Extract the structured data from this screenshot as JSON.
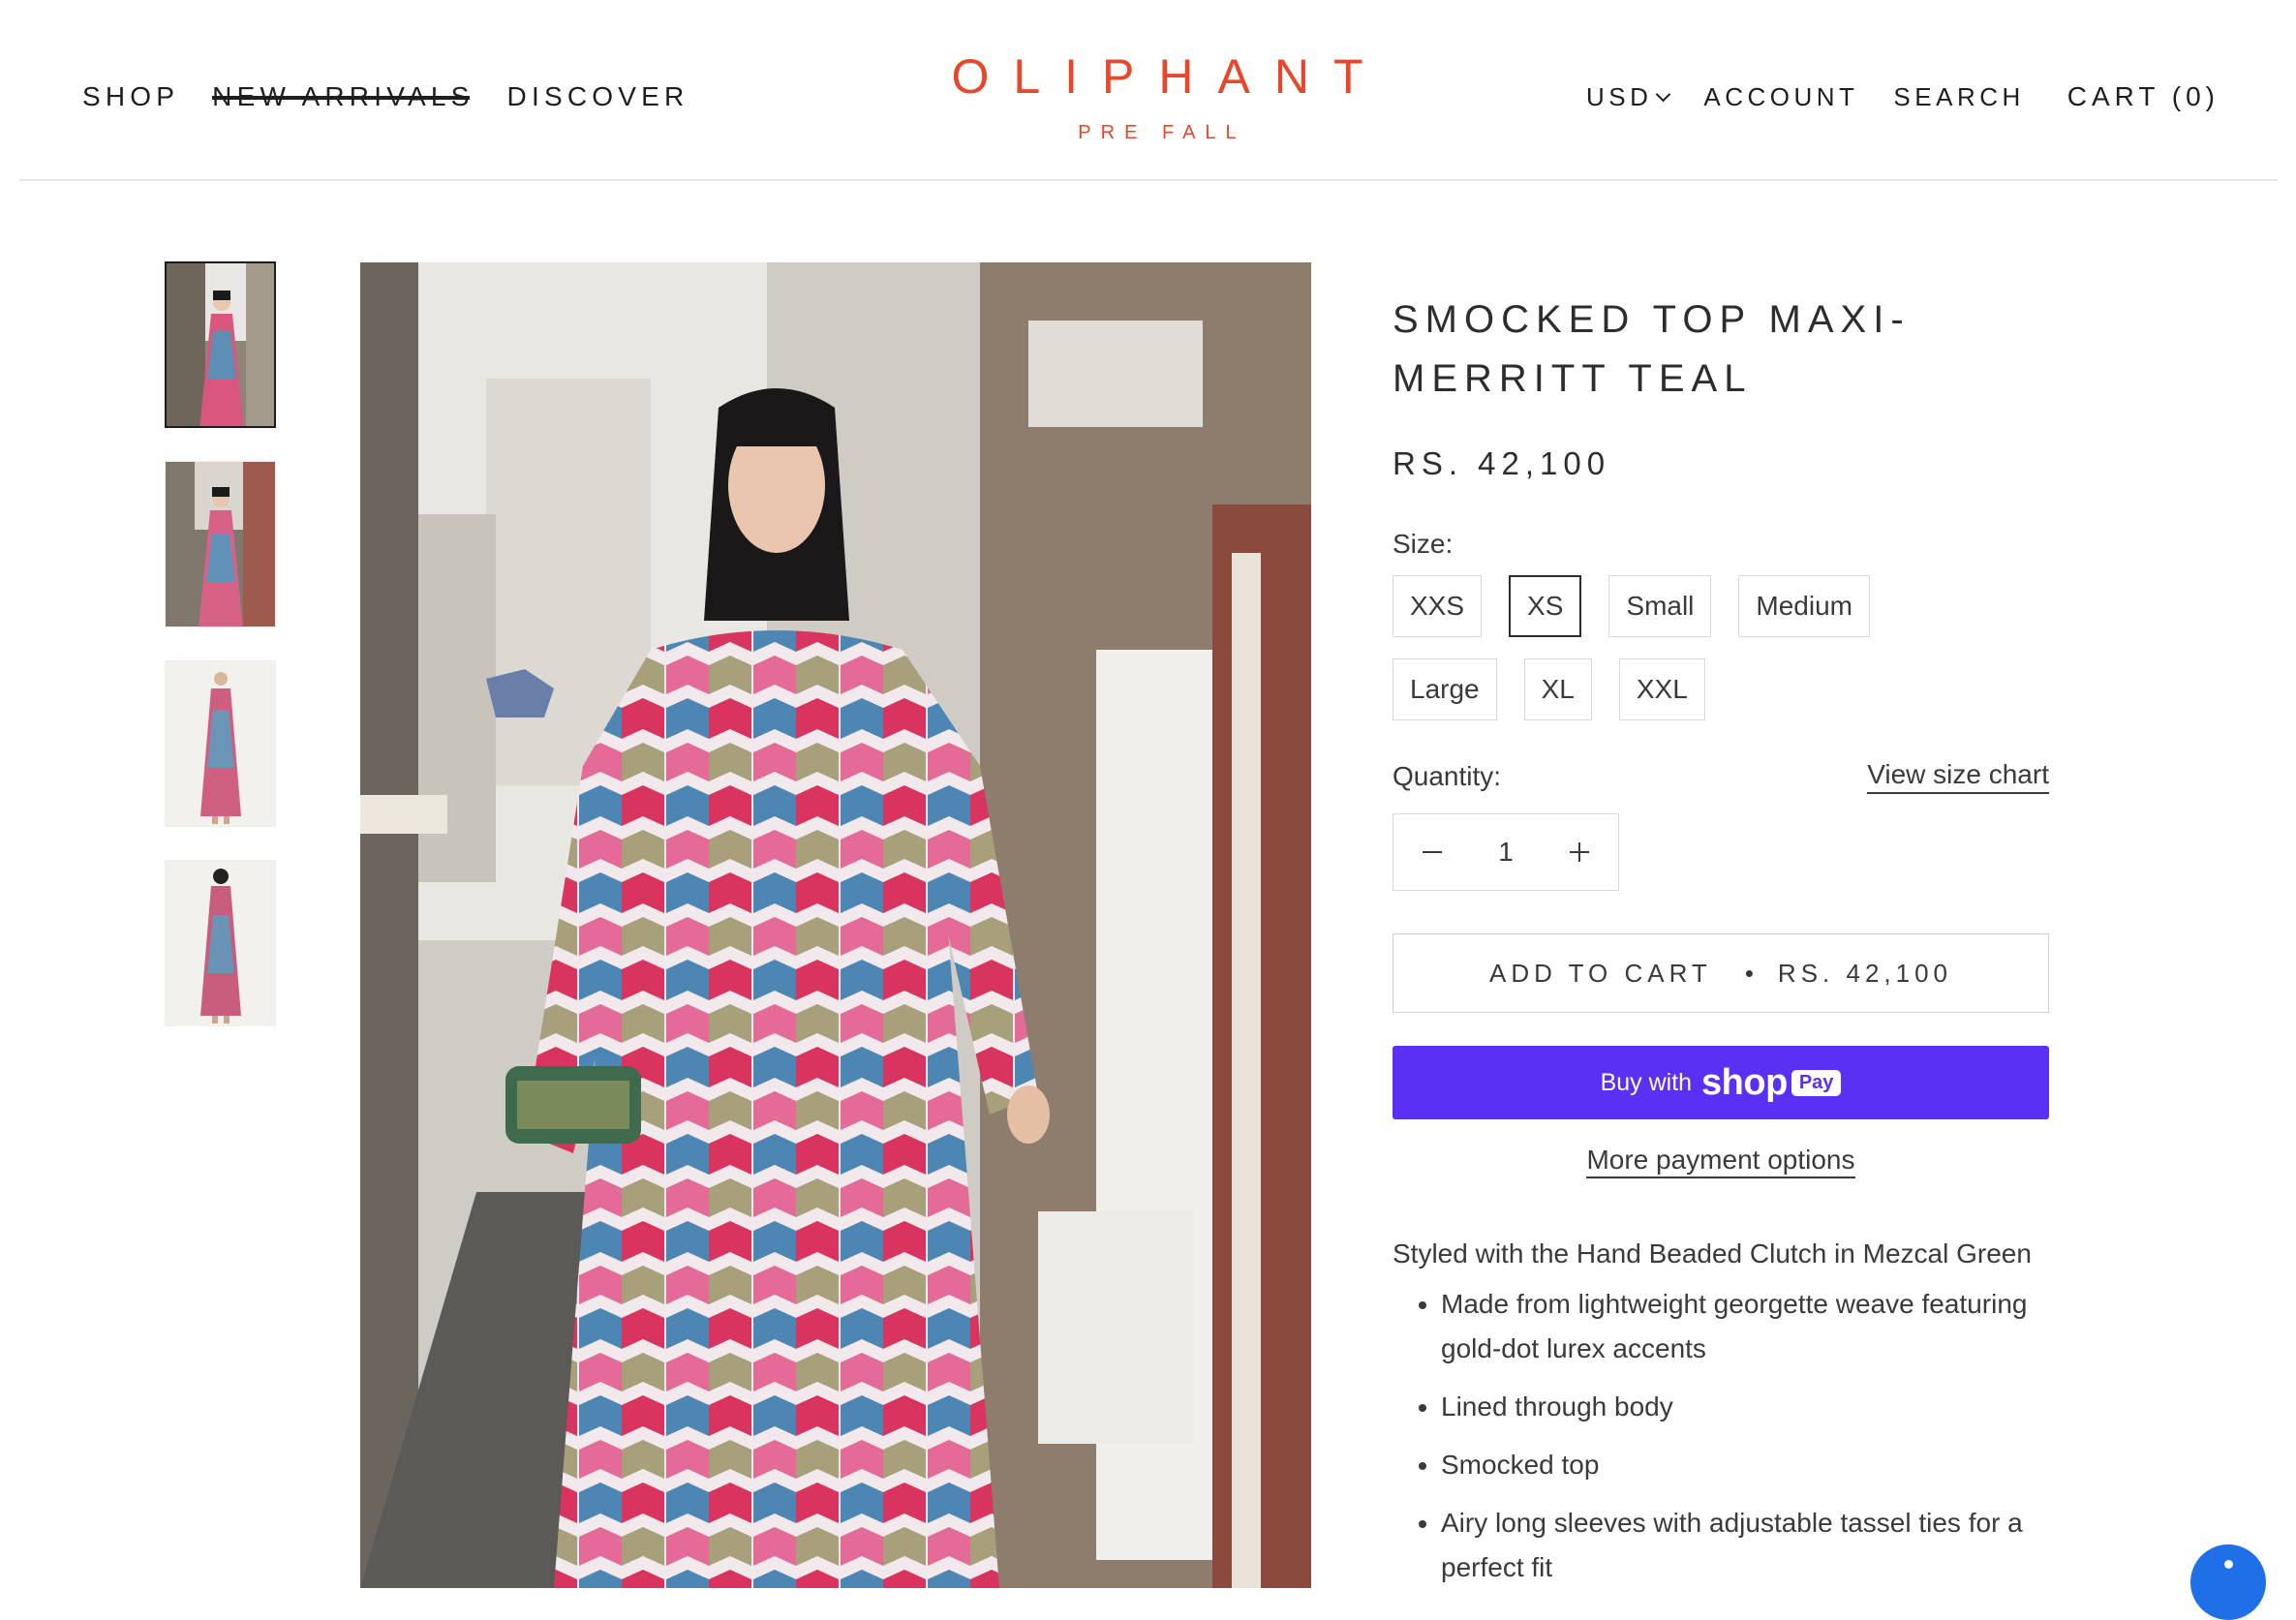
{
  "header": {
    "nav": [
      {
        "label": "SHOP"
      },
      {
        "label": "NEW ARRIVALS"
      },
      {
        "label": "DISCOVER"
      }
    ],
    "logo": {
      "main": "OLIPHANT",
      "sub": "PRE FALL"
    },
    "currency": "USD",
    "account": "ACCOUNT",
    "search": "SEARCH",
    "cart": "CART (0)"
  },
  "product": {
    "title": "SMOCKED TOP MAXI- MERRITT TEAL",
    "price": "RS. 42,100",
    "size_label": "Size:",
    "sizes": [
      "XXS",
      "XS",
      "Small",
      "Medium",
      "Large",
      "XL",
      "XXL"
    ],
    "selected_size": "XS",
    "quantity_label": "Quantity:",
    "size_chart_link": "View size chart",
    "quantity": "1",
    "add_to_cart": "ADD TO CART",
    "add_to_cart_dot": "•",
    "add_to_cart_price": "RS. 42,100",
    "shop_pay": {
      "prefix": "Buy with",
      "brand": "shop",
      "pill": "Pay"
    },
    "more_payment": "More payment options",
    "description": "Styled with the Hand Beaded Clutch in Mezcal Green",
    "bullets": [
      "Made from lightweight georgette weave featuring gold-dot lurex accents",
      "Lined through body",
      "Smocked top",
      "Airy long sleeves with adjustable tassel ties for a perfect fit"
    ]
  },
  "colors": {
    "brand": "#e8472b",
    "shop_pay": "#5a31f4",
    "chat": "#1e6fe8"
  },
  "icons": {
    "minus": "minus-icon",
    "plus": "plus-icon",
    "chevron": "chevron-down-icon",
    "chat": "chat-icon"
  }
}
